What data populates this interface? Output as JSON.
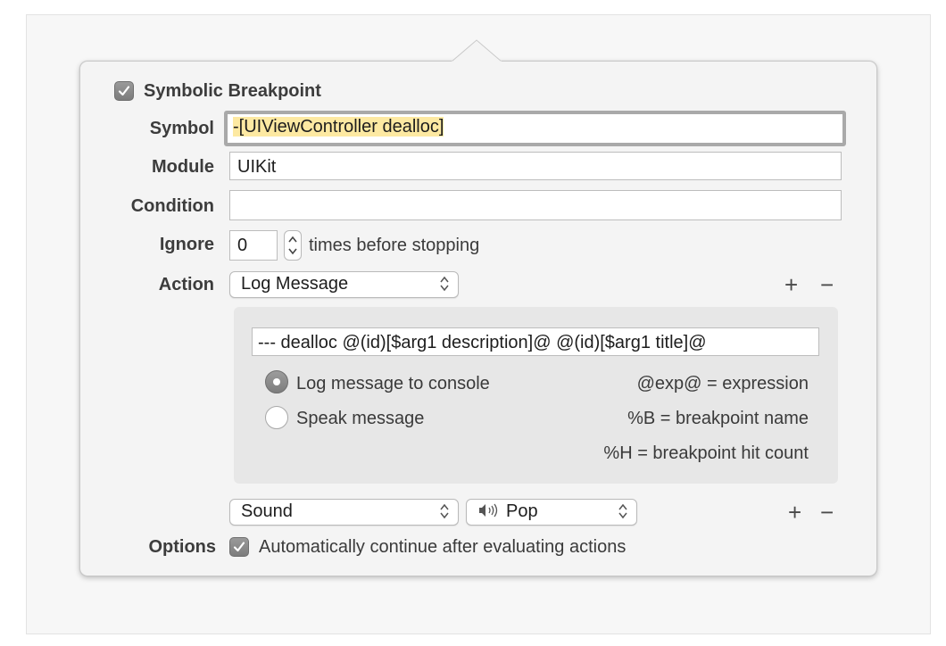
{
  "breakpoint": {
    "title": "Symbolic Breakpoint",
    "enabled": true
  },
  "labels": {
    "symbol": "Symbol",
    "module": "Module",
    "condition": "Condition",
    "ignore": "Ignore",
    "action": "Action",
    "options": "Options"
  },
  "fields": {
    "symbol_value": "-[UIViewController dealloc]",
    "module_value": "UIKit",
    "condition_value": "",
    "ignore_value": "0",
    "ignore_suffix": "times before stopping"
  },
  "actions": [
    {
      "type": "Log Message",
      "message": "--- dealloc @(id)[$arg1 description]@ @(id)[$arg1 title]@",
      "options": [
        {
          "label": "Log message to console",
          "selected": true
        },
        {
          "label": "Speak message",
          "selected": false
        }
      ],
      "hints": [
        "@exp@ = expression",
        "%B = breakpoint name",
        "%H = breakpoint hit count"
      ]
    },
    {
      "type": "Sound",
      "sound": "Pop"
    }
  ],
  "controls": {
    "add": "+",
    "remove": "−"
  },
  "options": {
    "auto_continue_label": "Automatically continue after evaluating actions",
    "auto_continue_checked": true
  },
  "icons": {
    "checkbox": "checkmark-icon",
    "popup": "chevron-updown-icon",
    "speaker": "speaker-icon"
  },
  "colors": {
    "highlight": "#fde9a2",
    "checkbox": "#8a8a8a"
  }
}
